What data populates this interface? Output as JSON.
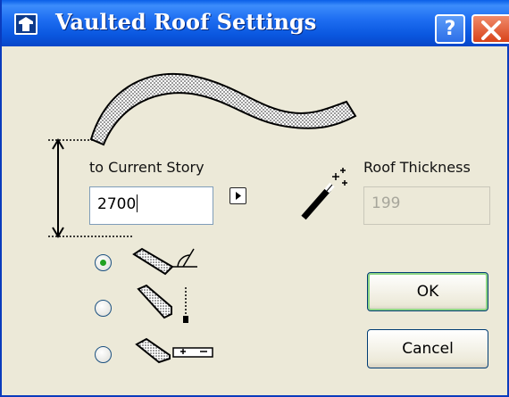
{
  "window": {
    "title": "Vaulted Roof Settings",
    "help_label": "?",
    "close_icon": "close-icon"
  },
  "colors": {
    "titlebar": "#0a57e0",
    "dialog_bg": "#ece9d8",
    "radio_selected": "#21a121",
    "default_button_ring": "#8fd685"
  },
  "form": {
    "story_label": "to Current Story",
    "story_value": "2700",
    "thickness_label": "Roof Thickness",
    "thickness_value": "199"
  },
  "options": [
    {
      "icon": "roof-angle-icon",
      "selected": true
    },
    {
      "icon": "roof-vertical-icon",
      "selected": false
    },
    {
      "icon": "roof-level-icon",
      "selected": false
    }
  ],
  "buttons": {
    "ok": "OK",
    "cancel": "Cancel"
  }
}
